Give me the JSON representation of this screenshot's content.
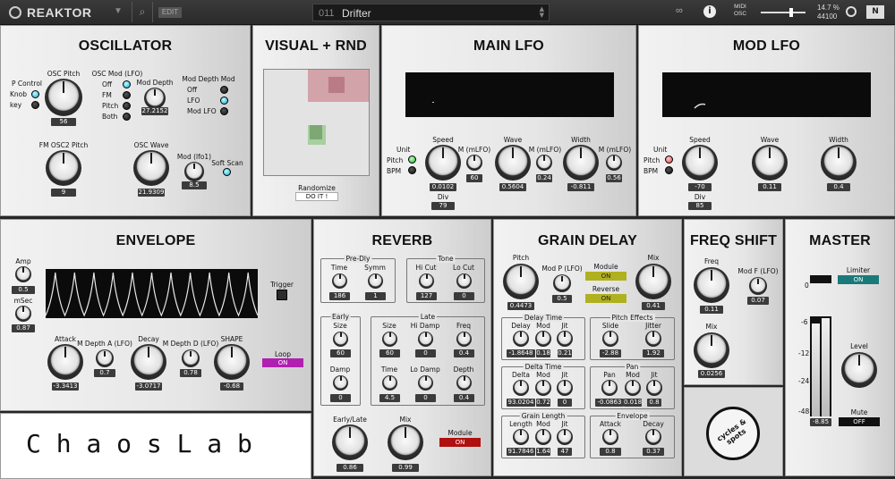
{
  "topbar": {
    "app_name": "REAKTOR",
    "edit": "EDIT",
    "preset_number": "011",
    "preset_name": "Drifter",
    "midi_osc": "MIDI\nOSC",
    "cpu": "14.7 %",
    "sample_rate": "44100"
  },
  "osc": {
    "title": "OSCILLATOR",
    "p_control": "P Control",
    "knob": "Knob",
    "key": "key",
    "osc_pitch": "OSC Pitch",
    "osc_pitch_val": "56",
    "osc_mod_lfo": "OSC Mod (LFO)",
    "mod_opts": [
      "Off",
      "FM",
      "Pitch",
      "Both"
    ],
    "mod_depth": "Mod Depth",
    "mod_depth_val": "27.2152",
    "mod_depth_mod": "Mod Depth Mod",
    "mdm_opts": [
      "Off",
      "LFO",
      "Mod LFO"
    ],
    "fm_osc2_pitch": "FM OSC2 Pitch",
    "fm_val": "9",
    "osc_wave": "OSC Wave",
    "osc_wave_val": "21.9309",
    "mod_lfo1": "Mod (lfo1)",
    "mod_lfo1_val": "8.5",
    "soft_scan": "Soft Scan"
  },
  "visual": {
    "title": "VISUAL + RND",
    "randomize": "Randomize",
    "do_it": "DO IT !"
  },
  "main_lfo": {
    "title": "MAIN LFO",
    "unit": "Unit",
    "pitch": "Pitch",
    "bpm": "BPM",
    "speed": "Speed",
    "speed_val": "0.0102",
    "m_mlfo": "M (mLFO)",
    "m1_val": "60",
    "div": "Div",
    "div_val": "79",
    "wave": "Wave",
    "wave_val": "0.5604",
    "m2_val": "0.24",
    "width": "Width",
    "width_val": "-0.811",
    "m3_val": "0.56"
  },
  "mod_lfo": {
    "title": "MOD LFO",
    "unit": "Unit",
    "pitch": "Pitch",
    "bpm": "BPM",
    "speed": "Speed",
    "speed_val": "-70",
    "div": "Div",
    "div_val": "85",
    "wave": "Wave",
    "wave_val": "0.11",
    "width": "Width",
    "width_val": "0.4"
  },
  "env": {
    "title": "ENVELOPE",
    "amp": "Amp",
    "amp_val": "0.5",
    "msec": "mSec",
    "msec_val": "0.87",
    "trigger": "Trigger",
    "attack": "Attack",
    "attack_val": "-3.3413",
    "mdepth_a": "M Depth A (LFO)",
    "mda_val": "0.7",
    "decay": "Decay",
    "decay_val": "-3.0717",
    "mdepth_d": "M Depth D (LFO)",
    "mdd_val": "0.78",
    "shape": "SHAPE",
    "shape_val": "-0.68",
    "loop": "Loop",
    "loop_state": "ON"
  },
  "brand": {
    "text": "C h a o s L a b"
  },
  "reverb": {
    "title": "REVERB",
    "predly": "Pre-Dly",
    "time": "Time",
    "time_val": "186",
    "symm": "Symm",
    "symm_val": "1",
    "tone": "Tone",
    "hicut": "Hi Cut",
    "hicut_val": "127",
    "locut": "Lo Cut",
    "locut_val": "0",
    "early": "Early",
    "size": "Size",
    "e_size_val": "60",
    "damp": "Damp",
    "damp_val": "0",
    "late": "Late",
    "l_size_val": "60",
    "hidamp": "Hi Damp",
    "hidamp_val": "0",
    "freq": "Freq",
    "freq_val": "0.4",
    "l_time_val": "4.5",
    "lodamp": "Lo Damp",
    "lodamp_val": "0",
    "depth": "Depth",
    "depth_val": "0.4",
    "early_late": "Early/Late",
    "el_val": "0.86",
    "mix": "Mix",
    "mix_val": "0.99",
    "module": "Module",
    "module_state": "ON"
  },
  "grain": {
    "title": "GRAIN DELAY",
    "pitch": "Pitch",
    "pitch_val": "0.4473",
    "modp": "Mod P (LFO)",
    "modp_val": "0.5",
    "module": "Module",
    "module_state": "ON",
    "reverse": "Reverse",
    "reverse_state": "ON",
    "mix": "Mix",
    "mix_val": "0.41",
    "delay_time": "Delay Time",
    "delay": "Delay",
    "dt_delay_val": "-1.8648",
    "mod": "Mod",
    "dt_mod_val": "0.18",
    "jit": "Jit",
    "dt_jit_val": "0.21",
    "pitch_effects": "Pitch Effects",
    "slide": "Slide",
    "slide_val": "-2.88",
    "jitter": "Jitter",
    "jitter_val": "1.92",
    "delta_time": "Delta Time",
    "delta": "Delta",
    "delta_val": "93.0204",
    "dl_mod_val": "0.72",
    "dl_jit_val": "0",
    "pan": "Pan",
    "pan_pan_val": "-0.0863",
    "pan_mod_val": "0.018",
    "pan_jit_val": "0.8",
    "grain_length": "Grain Length",
    "length": "Length",
    "length_val": "91.7846",
    "gl_mod_val": "1.64",
    "gl_jit_val": "47",
    "envelope": "Envelope",
    "attack": "Attack",
    "attack_val": "0.8",
    "decay": "Decay",
    "decay_val": "0.37"
  },
  "freq": {
    "title": "FREQ SHIFT",
    "freq": "Freq",
    "freq_val": "0.11",
    "modf": "Mod F (LFO)",
    "modf_val": "0.07",
    "mix": "Mix",
    "mix_val": "0.0256",
    "logo": "cycles & spots"
  },
  "master": {
    "title": "MASTER",
    "zero": "0",
    "limiter": "Limiter",
    "limiter_state": "ON",
    "ticks": [
      "-6",
      "-12",
      "-24",
      "-48"
    ],
    "meter_val": "-8.85",
    "level": "Level",
    "mute": "Mute",
    "mute_state": "OFF"
  },
  "colors": {
    "led_on": "#1aa7d6",
    "loop": "#b01fb0",
    "reverb_module": "#b01010",
    "grain_on": "#b0b020",
    "limiter": "#1a7a7a"
  }
}
